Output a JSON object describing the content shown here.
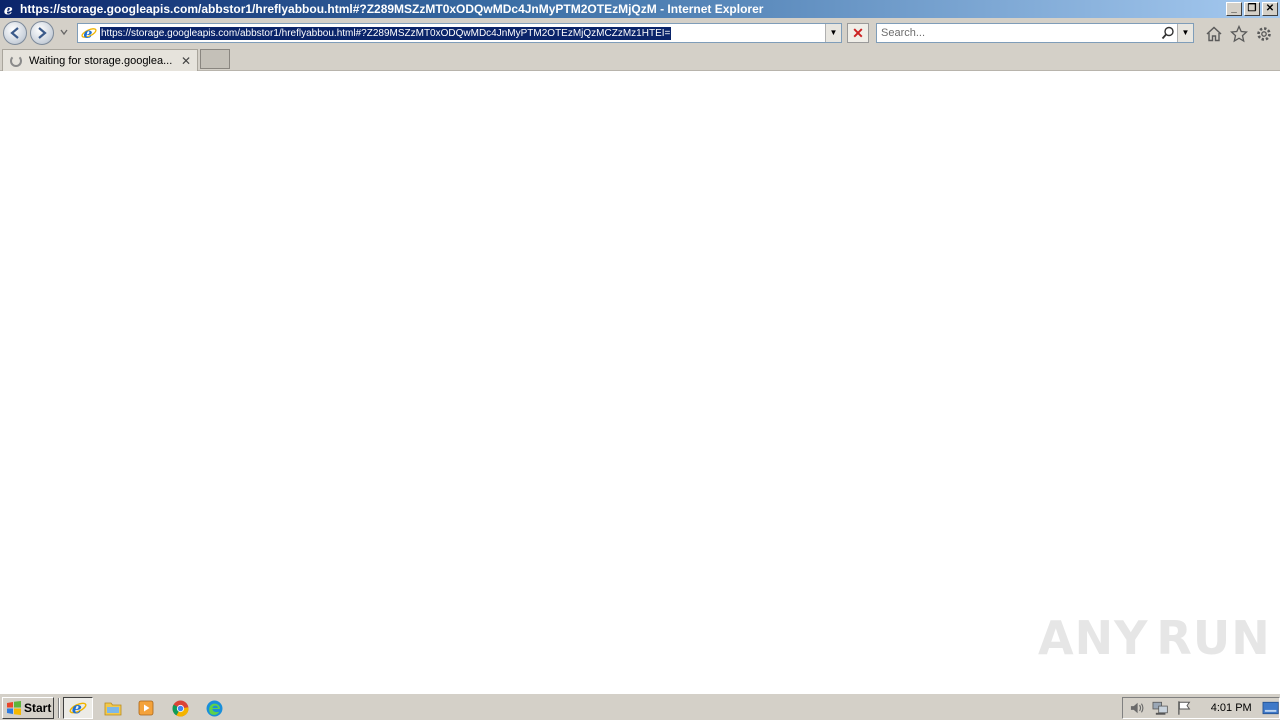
{
  "window": {
    "title": "https://storage.googleapis.com/abbstor1/hreflyabbou.html#?Z289MSZzMT0xODQwMDc4JnMyPTM2OTEzMjQzM - Internet Explorer",
    "minimize": "_",
    "restore": "❐",
    "close": "✕"
  },
  "navbar": {
    "address": "https://storage.googleapis.com/abbstor1/hreflyabbou.html#?Z289MSZzMT0xODQwMDc4JnMyPTM2OTEzMjQzMCZzMz1HTEI=",
    "address_dropdown": "▼",
    "stop": "✕",
    "search_placeholder": "Search...",
    "search_dropdown": "▼"
  },
  "tabs": [
    {
      "label": "Waiting for storage.googlea...",
      "close": "✕"
    }
  ],
  "watermark": {
    "left": "ANY",
    "right": "RUN"
  },
  "taskbar": {
    "start_label": "Start",
    "clock": "4:01 PM"
  },
  "colors": {
    "chrome": "#d4d0c8",
    "title_gradient_start": "#0a246a",
    "selection": "#0a246a",
    "ie_blue": "#1e6fd0",
    "ie_ring": "#f0b400"
  }
}
